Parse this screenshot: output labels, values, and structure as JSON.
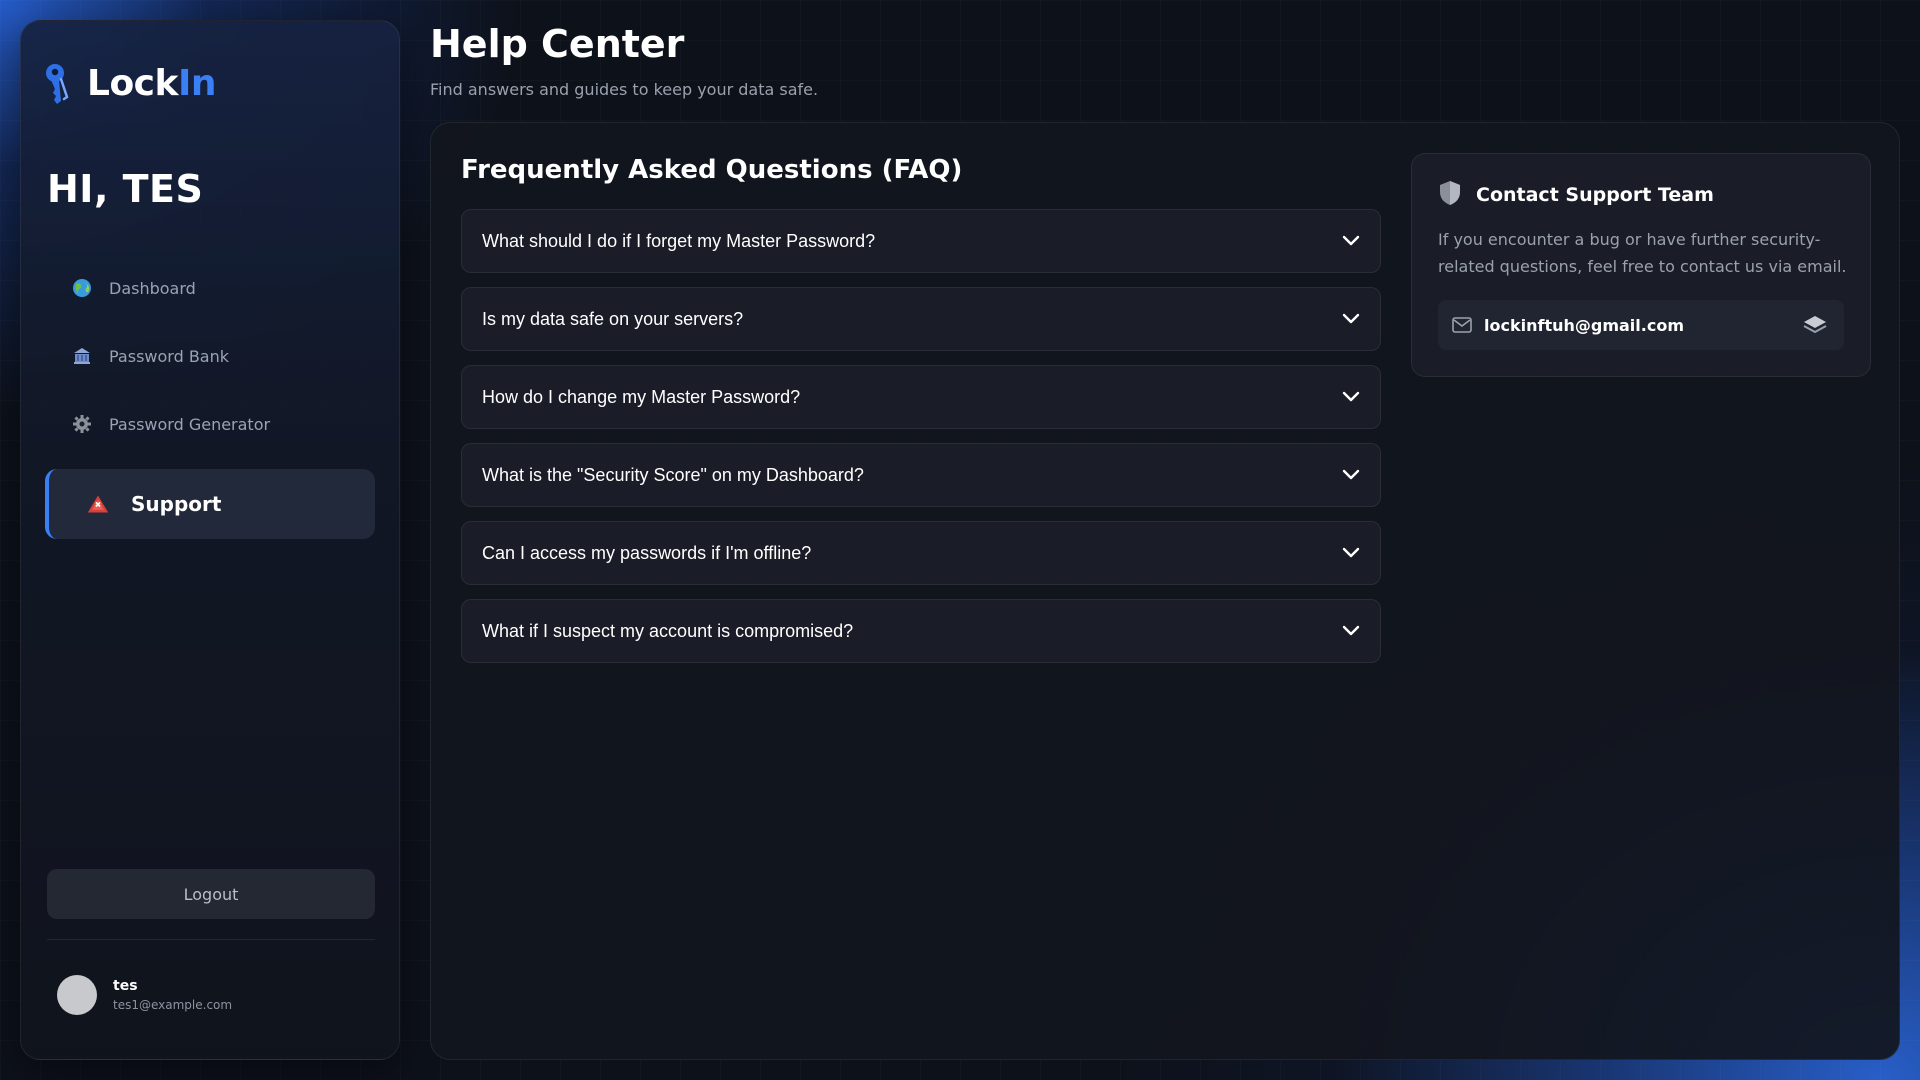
{
  "brand": {
    "lock": "Lock",
    "in": "In"
  },
  "sidebar": {
    "greeting": "HI, TES",
    "items": [
      {
        "label": "Dashboard",
        "icon": "globe-icon"
      },
      {
        "label": "Password Bank",
        "icon": "bank-icon"
      },
      {
        "label": "Password Generator",
        "icon": "gear-icon"
      },
      {
        "label": "Support",
        "icon": "warning-icon",
        "active": true
      }
    ],
    "logout_label": "Logout",
    "user": {
      "name": "tes",
      "email": "tes1@example.com"
    }
  },
  "header": {
    "title": "Help Center",
    "subtitle": "Find answers and guides to keep your data safe."
  },
  "faq": {
    "title": "Frequently Asked Questions (FAQ)",
    "items": [
      "What should I do if I forget my Master Password?",
      "Is my data safe on your servers?",
      "How do I change my Master Password?",
      "What is the \"Security Score\" on my Dashboard?",
      "Can I access my passwords if I'm offline?",
      "What if I suspect my account is compromised?"
    ]
  },
  "contact": {
    "title": "Contact Support Team",
    "description": "If you encounter a bug or have further security-related questions, feel free to contact us via email.",
    "email": "lockinftuh@gmail.com"
  },
  "colors": {
    "accent": "#3b7ff5",
    "background": "#0d111a",
    "panel": "#12151e"
  }
}
